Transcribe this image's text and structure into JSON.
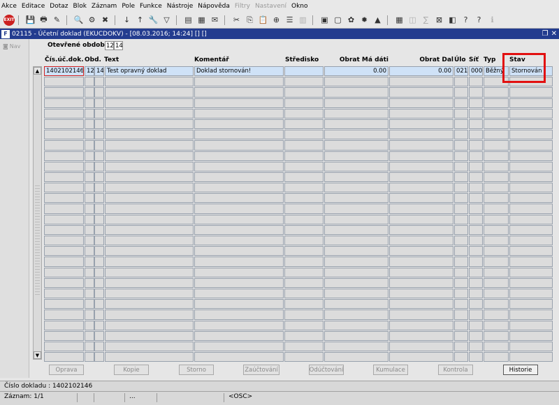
{
  "menu": [
    "Akce",
    "Editace",
    "Dotaz",
    "Blok",
    "Záznam",
    "Pole",
    "Funkce",
    "Nástroje",
    "Nápověda",
    "Filtry",
    "Nastavení",
    "Okno"
  ],
  "menu_disabled": [
    "Filtry",
    "Nastavení"
  ],
  "toolbar": {
    "exit_label": "EXIT",
    "icons": [
      "exit-icon",
      "save-icon",
      "print-icon",
      "clear-icon",
      "query-icon",
      "execute-query-icon",
      "cancel-query-icon",
      "sort-asc-icon",
      "sort-desc-icon",
      "wrench-icon",
      "filter-icon",
      "print-report-icon",
      "detail-icon",
      "mail-icon",
      "cut-icon",
      "copy-icon",
      "paste-icon",
      "insert-record-icon",
      "delete-record-icon",
      "calculator-icon",
      "document-icon",
      "attach-icon",
      "gear-icon",
      "sun-icon",
      "warning-icon",
      "calendar-icon",
      "export-icon",
      "graph-icon",
      "excel-icon",
      "database-icon",
      "help-icon",
      "context-help-icon",
      "info-icon"
    ]
  },
  "window": {
    "title": "02115 - Účetní doklad (EKUCDOKV) - [08.03.2016; 14:24] [] []",
    "restore_icon": "restore-icon",
    "close_icon": "close-icon"
  },
  "nav": {
    "label": "Nav"
  },
  "period": {
    "label": "Otevřené období",
    "values": [
      "12",
      "14"
    ]
  },
  "columns": [
    "Čís.úč.dok.",
    "Obd.",
    "Text",
    "Komentář",
    "Středisko",
    "Obrat Má dáti",
    "Obrat Dal",
    "Úlo",
    "Síť",
    "Typ",
    "Stav"
  ],
  "rows": [
    [
      "1402102146",
      "12",
      "14",
      "Test opravný doklad",
      "Doklad stornován!",
      "",
      "0.00",
      "0.00",
      "021",
      "000",
      "Běžný",
      "Stornován"
    ]
  ],
  "empty_row_count": 27,
  "buttons": [
    {
      "label": "Oprava",
      "enabled": false
    },
    {
      "label": "Kopie",
      "enabled": false
    },
    {
      "label": "Storno",
      "enabled": false
    },
    {
      "label": "Zaúčtování",
      "enabled": false
    },
    {
      "label": "Odúčtování",
      "enabled": false
    },
    {
      "label": "Kumulace",
      "enabled": false
    },
    {
      "label": "Kontrola",
      "enabled": false
    },
    {
      "label": "Historie",
      "enabled": true
    }
  ],
  "status": {
    "line1": "Číslo dokladu : 1402102146",
    "record": "Záznam: 1/1",
    "ellipsis": "...",
    "mode": "<OSC>"
  },
  "colors": {
    "titlebar": "#233c8f",
    "highlight": "#e21010",
    "active_row": "#cfe2f7"
  }
}
